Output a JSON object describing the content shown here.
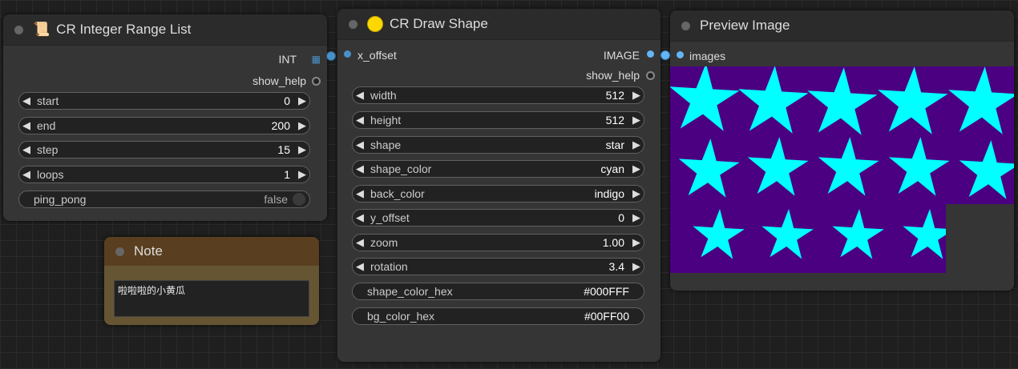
{
  "range_node": {
    "title": "CR Integer Range List",
    "icon": "scroll-icon",
    "output_int": "INT",
    "show_help": "show_help",
    "widgets": [
      {
        "label": "start",
        "value": "0"
      },
      {
        "label": "end",
        "value": "200"
      },
      {
        "label": "step",
        "value": "15"
      },
      {
        "label": "loops",
        "value": "1"
      }
    ],
    "toggle": {
      "label": "ping_pong",
      "value": "false"
    }
  },
  "note_node": {
    "title": "Note",
    "text": "啦啦啦的小黄瓜"
  },
  "draw_node": {
    "title": "CR Draw Shape",
    "input_slot": "x_offset",
    "output_image": "IMAGE",
    "show_help": "show_help",
    "widgets": [
      {
        "label": "width",
        "value": "512"
      },
      {
        "label": "height",
        "value": "512"
      },
      {
        "label": "shape",
        "value": "star"
      },
      {
        "label": "shape_color",
        "value": "cyan"
      },
      {
        "label": "back_color",
        "value": "indigo"
      },
      {
        "label": "y_offset",
        "value": "0"
      },
      {
        "label": "zoom",
        "value": "1.00"
      },
      {
        "label": "rotation",
        "value": "3.4"
      }
    ],
    "text_widgets": [
      {
        "label": "shape_color_hex",
        "value": "#000FFF"
      },
      {
        "label": "bg_color_hex",
        "value": "#00FF00"
      }
    ]
  },
  "preview_node": {
    "title": "Preview Image",
    "input_slot": "images"
  },
  "colors": {
    "shape": "#00ffff",
    "background": "#4b0082",
    "int_slot": "#4a90c8",
    "image_slot": "#64b5f6"
  }
}
